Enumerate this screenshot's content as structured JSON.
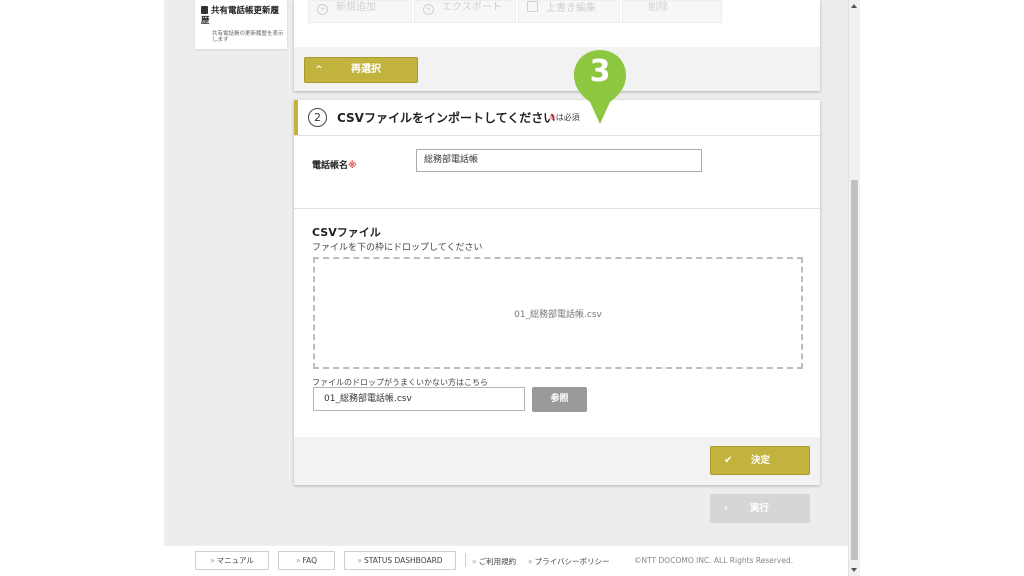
{
  "sidebar": {
    "title": "共有電話帳更新履歴",
    "description": "共有電話帳の更新履歴を表示します"
  },
  "toolbar": {
    "new_label": "新規追加",
    "export_label": "エクスポート",
    "overwrite_label": "上書き編集",
    "delete_label": "削除"
  },
  "step1": {
    "reselect_label": "再選択"
  },
  "step2": {
    "number": "②",
    "title": "CSVファイルをインポートしてください",
    "required_note": "は必須",
    "required_mark": "※",
    "phonebook_name_label": "電話帳名",
    "phonebook_name_value": "総務部電話帳",
    "csv_heading": "CSVファイル",
    "csv_sub": "ファイルを下の枠にドロップしてください",
    "dropped_file": "01_総務部電話帳.csv",
    "browse_hint": "ファイルのドロップがうまくいかない方はこちら",
    "file_value": "01_総務部電話帳.csv",
    "browse_label": "参照",
    "decide_label": "決定"
  },
  "execute_label": "実行",
  "balloon_number": "3",
  "footer": {
    "manual": "マニュアル",
    "faq": "FAQ",
    "status": "STATUS DASHBOARD",
    "terms": "ご利用規約",
    "privacy": "プライバシーポリシー",
    "copyright": "©NTT DOCOMO INC. ALL Rights Reserved."
  },
  "colors": {
    "accent": "#c2b23e",
    "balloon": "#8dc63f",
    "required": "#e0484b"
  }
}
